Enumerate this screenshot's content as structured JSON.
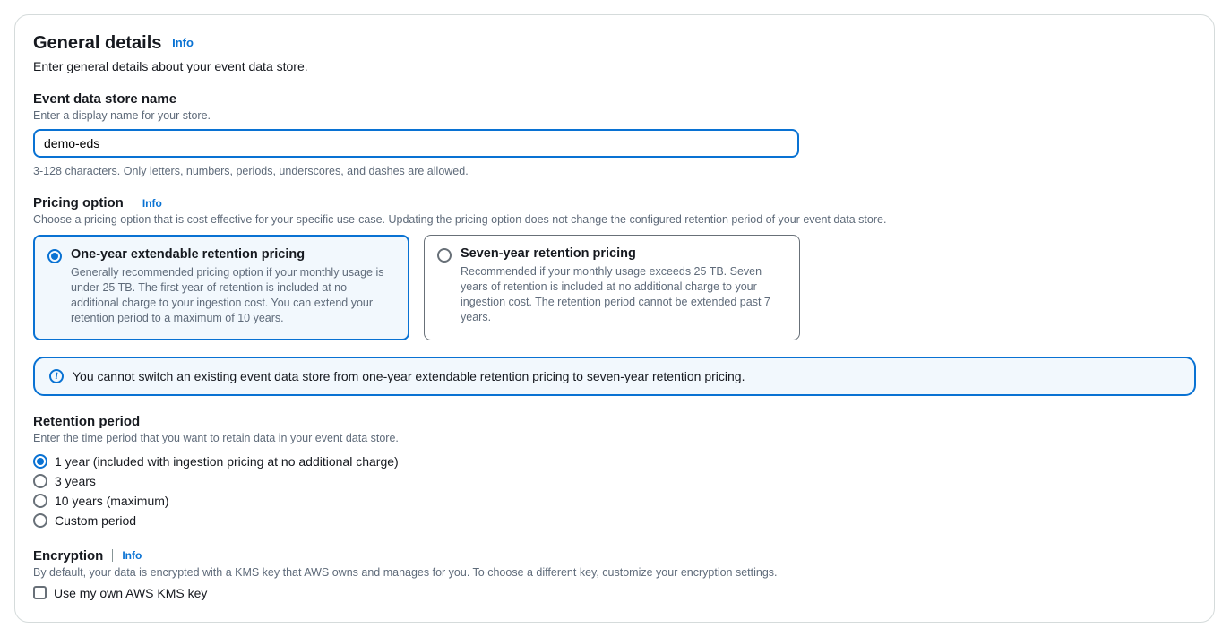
{
  "header": {
    "title": "General details",
    "info": "Info",
    "subtitle": "Enter general details about your event data store."
  },
  "nameField": {
    "label": "Event data store name",
    "hint": "Enter a display name for your store.",
    "value": "demo-eds",
    "constraint": "3-128 characters. Only letters, numbers, periods, underscores, and dashes are allowed."
  },
  "pricing": {
    "label": "Pricing option",
    "info": "Info",
    "hint": "Choose a pricing option that is cost effective for your specific use-case. Updating the pricing option does not change the configured retention period of your event data store.",
    "options": [
      {
        "title": "One-year extendable retention pricing",
        "desc": "Generally recommended pricing option if your monthly usage is under 25 TB. The first year of retention is included at no additional charge to your ingestion cost. You can extend your retention period to a maximum of 10 years.",
        "selected": true
      },
      {
        "title": "Seven-year retention pricing",
        "desc": "Recommended if your monthly usage exceeds 25 TB. Seven years of retention is included at no additional charge to your ingestion cost. The retention period cannot be extended past 7 years.",
        "selected": false
      }
    ],
    "alert": "You cannot switch an existing event data store from one-year extendable retention pricing to seven-year retention pricing."
  },
  "retention": {
    "label": "Retention period",
    "hint": "Enter the time period that you want to retain data in your event data store.",
    "options": [
      {
        "label": "1 year (included with ingestion pricing at no additional charge)",
        "selected": true
      },
      {
        "label": "3 years",
        "selected": false
      },
      {
        "label": "10 years (maximum)",
        "selected": false
      },
      {
        "label": "Custom period",
        "selected": false
      }
    ]
  },
  "encryption": {
    "label": "Encryption",
    "info": "Info",
    "hint": "By default, your data is encrypted with a KMS key that AWS owns and manages for you. To choose a different key, customize your encryption settings.",
    "checkboxLabel": "Use my own AWS KMS key"
  }
}
